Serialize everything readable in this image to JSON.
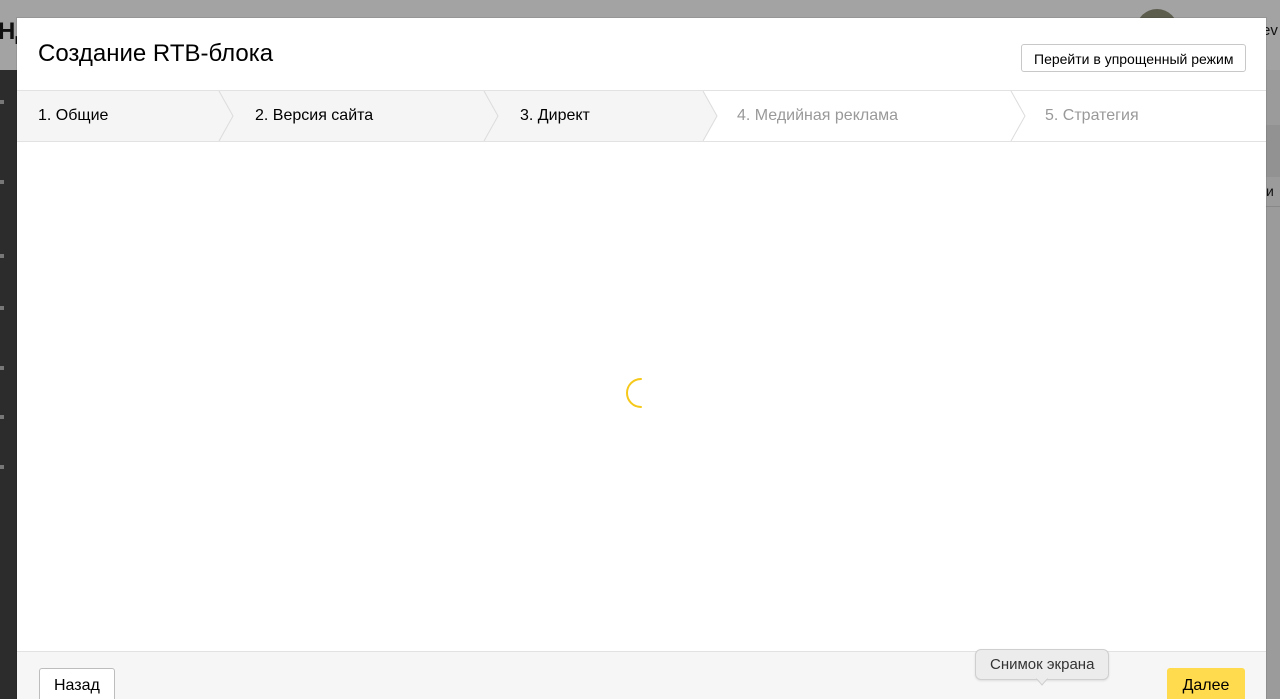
{
  "background": {
    "logo_fragment": "НД",
    "user_fragment": "ev",
    "right_text_fragment": "и"
  },
  "modal": {
    "title": "Создание RTB-блока",
    "simple_mode_button": "Перейти в упрощенный режим"
  },
  "steps": [
    {
      "label": "1. Общие",
      "state": "done"
    },
    {
      "label": "2. Версия сайта",
      "state": "done"
    },
    {
      "label": "3. Директ",
      "state": "done"
    },
    {
      "label": "4. Медийная реклама",
      "state": "todo"
    },
    {
      "label": "5. Стратегия",
      "state": "todo"
    }
  ],
  "loader": {
    "icon": "spinner-icon",
    "color": "#f5c81a"
  },
  "footer": {
    "back_button": "Назад",
    "next_button": "Далее"
  },
  "tooltip": {
    "text": "Снимок экрана"
  },
  "colors": {
    "accent": "#ffdb4d",
    "step_active_bg": "#f5f5f5",
    "step_inactive_text": "#999999"
  }
}
